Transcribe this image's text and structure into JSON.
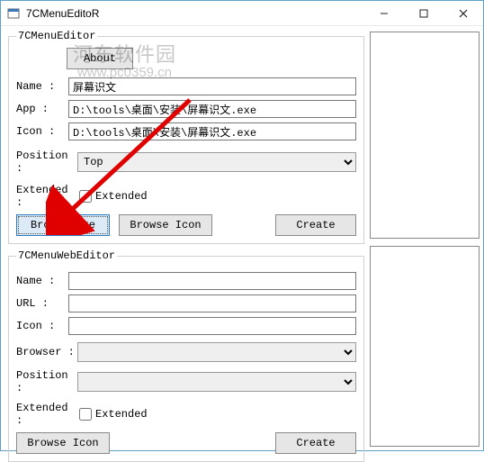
{
  "window": {
    "title": "7CMenuEditoR"
  },
  "watermark": {
    "line1": "河东软件园",
    "line2": "www.pc0359.cn"
  },
  "group1": {
    "legend": "7CMenuEditor",
    "about": "About",
    "name_label": "Name :",
    "name_value": "屏幕识文",
    "app_label": "App :",
    "app_value": "D:\\tools\\桌面\\安装\\屏幕识文.exe",
    "icon_label": "Icon :",
    "icon_value": "D:\\tools\\桌面\\安装\\屏幕识文.exe",
    "position_label": "Position :",
    "position_value": "Top",
    "extended_label": "Extended :",
    "extended_cb": "Extended",
    "browse_exe": "Browse Exe",
    "browse_icon": "Browse Icon",
    "create": "Create"
  },
  "group2": {
    "legend": "7CMenuWebEditor",
    "name_label": "Name :",
    "name_value": "",
    "url_label": "URL :",
    "url_value": "",
    "icon_label": "Icon :",
    "icon_value": "",
    "browser_label": "Browser :",
    "browser_value": "",
    "position_label": "Position :",
    "position_value": "",
    "extended_label": "Extended :",
    "extended_cb": "Extended",
    "browse_icon": "Browse Icon",
    "create": "Create"
  }
}
